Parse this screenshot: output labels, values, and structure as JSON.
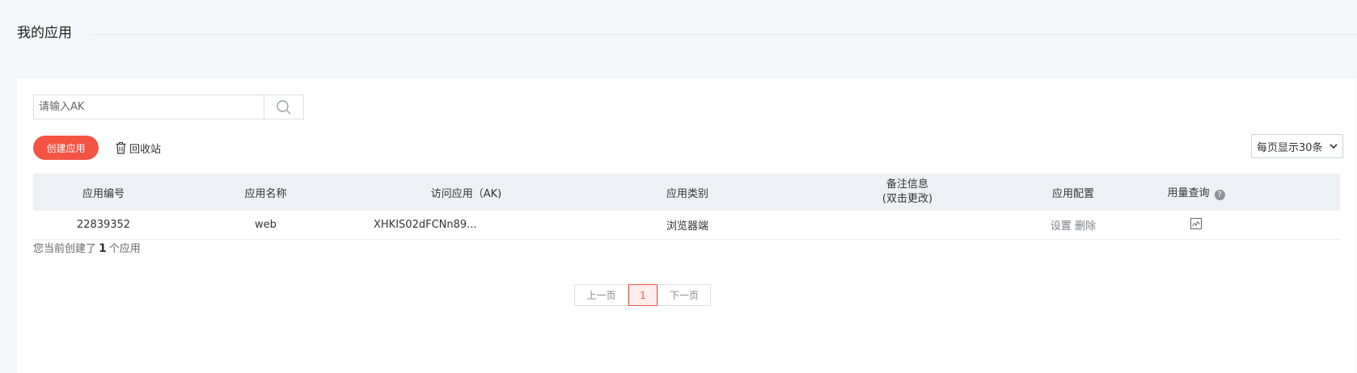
{
  "header": {
    "title": "我的应用"
  },
  "search": {
    "placeholder": "请输入AK",
    "value": ""
  },
  "toolbar": {
    "create_label": "创建应用",
    "recycle_label": "回收站",
    "page_size_label": "每页显示30条"
  },
  "table": {
    "columns": {
      "id": "应用编号",
      "name": "应用名称",
      "ak": "访问应用（AK)",
      "type": "应用类别",
      "remark_line1": "备注信息",
      "remark_line2": "(双击更改)",
      "config": "应用配置",
      "usage": "用量查询"
    },
    "rows": [
      {
        "id": "22839352",
        "name": "web",
        "ak": "XHKIS02dFCNn89...",
        "type": "浏览器端",
        "remark": "",
        "config_set": "设置",
        "config_delete": "删除"
      }
    ]
  },
  "summary": {
    "prefix": "您当前创建了",
    "count": "1",
    "suffix": "个应用"
  },
  "pagination": {
    "prev": "上一页",
    "current": "1",
    "next": "下一页"
  },
  "colors": {
    "accent": "#f35444",
    "header_bg": "#edf0f4",
    "page_bg": "#f5f6f9"
  },
  "icons": {
    "search": "search-icon",
    "recycle": "trash-icon",
    "help": "help-icon",
    "usage": "chart-icon",
    "select": "chevron-down-icon"
  }
}
